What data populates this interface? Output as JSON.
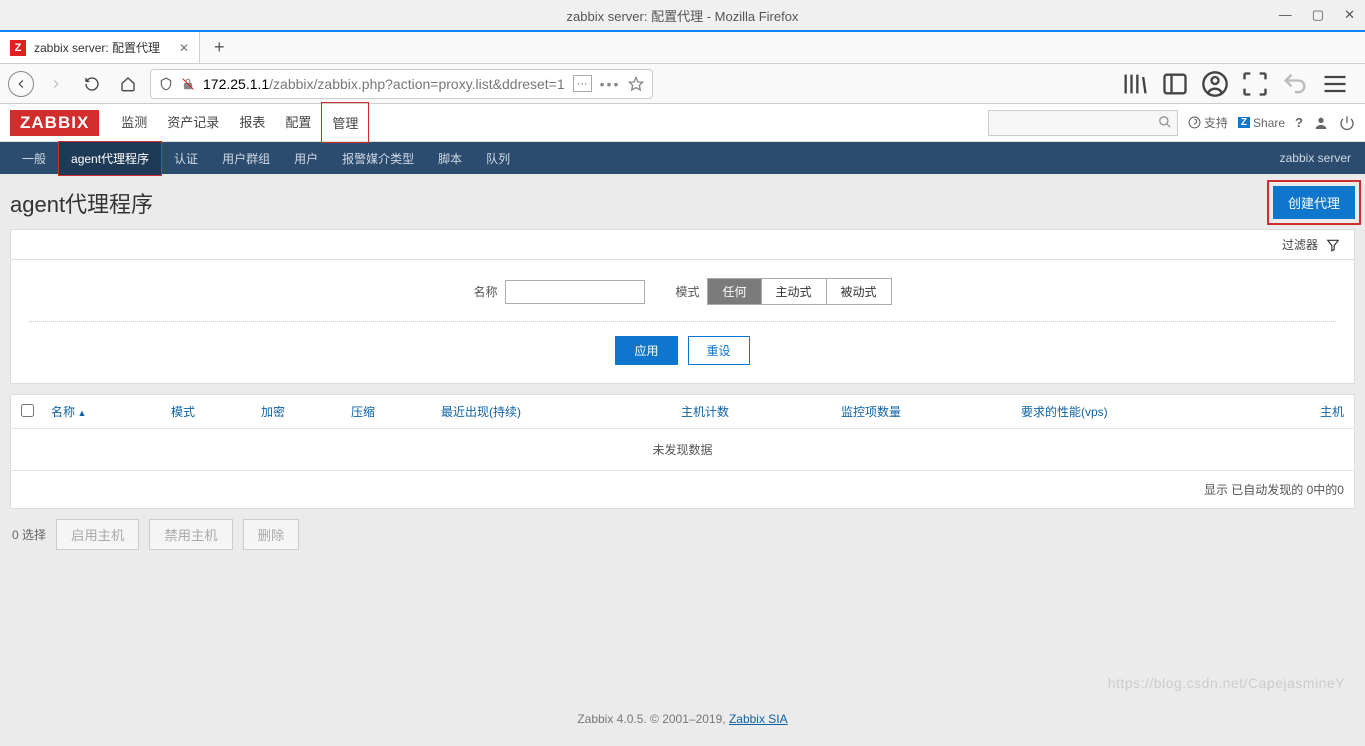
{
  "window": {
    "title": "zabbix server: 配置代理 - Mozilla Firefox"
  },
  "tab": {
    "title": "zabbix server: 配置代理"
  },
  "url": {
    "host": "172.25.1.1",
    "path": "/zabbix/zabbix.php?action=proxy.list&ddreset=1"
  },
  "zbx": {
    "logo": "ZABBIX",
    "nav": [
      "监测",
      "资产记录",
      "报表",
      "配置",
      "管理"
    ],
    "nav_active": 4,
    "support": "支持",
    "share": "Share"
  },
  "subnav": {
    "items": [
      "一般",
      "agent代理程序",
      "认证",
      "用户群组",
      "用户",
      "报警媒介类型",
      "脚本",
      "队列"
    ],
    "active": 1,
    "right": "zabbix server"
  },
  "page": {
    "title": "agent代理程序",
    "create_btn": "创建代理",
    "filter_label": "过滤器"
  },
  "filter": {
    "name_label": "名称",
    "mode_label": "模式",
    "mode_opts": [
      "任何",
      "主动式",
      "被动式"
    ],
    "apply": "应用",
    "reset": "重设"
  },
  "table": {
    "cols": {
      "name": "名称",
      "mode": "模式",
      "enc": "加密",
      "comp": "压缩",
      "last": "最近出现(持续)",
      "hosts": "主机计数",
      "items": "监控项数量",
      "perf": "要求的性能(vps)",
      "host": "主机"
    },
    "empty": "未发现数据",
    "footer": "显示 已自动发现的 0中的0"
  },
  "batch": {
    "selected": "0 选择",
    "enable": "启用主机",
    "disable": "禁用主机",
    "delete": "删除"
  },
  "footer": {
    "text": "Zabbix 4.0.5. © 2001–2019, ",
    "link": "Zabbix SIA"
  },
  "watermark": "https://blog.csdn.net/CapejasmineY"
}
